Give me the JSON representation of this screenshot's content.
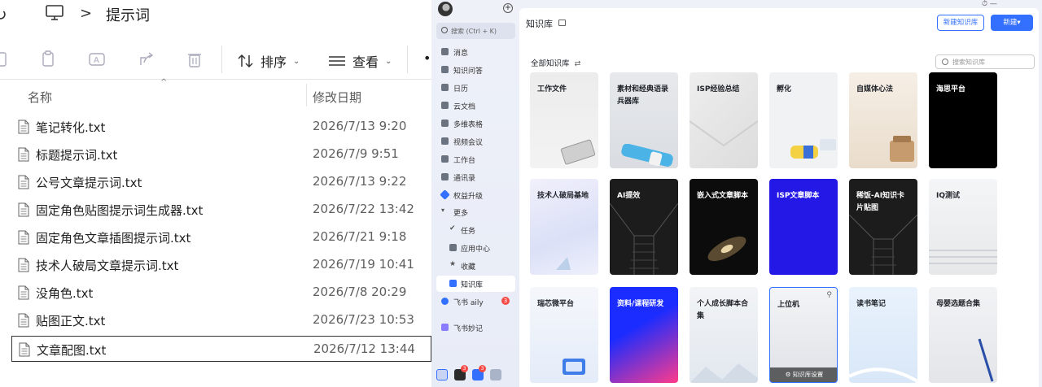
{
  "explorer": {
    "breadcrumb": "提示词",
    "toolbar": {
      "sort_label": "排序",
      "view_label": "查看"
    },
    "columns": {
      "name": "名称",
      "date": "修改日期"
    },
    "files": [
      {
        "name": "笔记转化.txt",
        "date": "2026/7/13 9:20"
      },
      {
        "name": "标题提示词.txt",
        "date": "2026/7/9 9:51"
      },
      {
        "name": "公号文章提示词.txt",
        "date": "2026/7/13 9:22"
      },
      {
        "name": "固定角色贴图提示词生成器.txt",
        "date": "2026/7/22 13:42"
      },
      {
        "name": "固定角色文章插图提示词.txt",
        "date": "2026/7/21 9:18"
      },
      {
        "name": "技术人破局文章提示词.txt",
        "date": "2026/7/19 10:41"
      },
      {
        "name": "没角色.txt",
        "date": "2026/7/8 20:29"
      },
      {
        "name": "贴图正文.txt",
        "date": "2026/7/23 10:53"
      },
      {
        "name": "文章配图.txt",
        "date": "2026/7/12 13:44"
      }
    ]
  },
  "feishu": {
    "search_placeholder": "搜索 (Ctrl + K)",
    "nav": [
      {
        "label": "消息"
      },
      {
        "label": "知识问答"
      },
      {
        "label": "日历"
      },
      {
        "label": "云文档"
      },
      {
        "label": "多维表格"
      },
      {
        "label": "视频会议"
      },
      {
        "label": "工作台"
      },
      {
        "label": "通讯录"
      },
      {
        "label": "权益升级"
      },
      {
        "label": "更多"
      },
      {
        "label": "任务"
      },
      {
        "label": "应用中心"
      },
      {
        "label": "收藏"
      },
      {
        "label": "知识库"
      },
      {
        "label": "飞书 aily",
        "badge": "3"
      },
      {
        "label": "飞书妙记"
      }
    ],
    "bottom_badges": [
      "3",
      "3"
    ],
    "page_title": "知识库",
    "btn_new_kb": "新建知识库",
    "btn_new": "新建▾",
    "all_kb_label": "全部知识库",
    "all_kb_icon": "⇄",
    "kb_search_placeholder": "搜索知识库",
    "top_fragment": "⏱  —",
    "cards": [
      {
        "label": "工作文件"
      },
      {
        "label": "素材和经典语录兵器库"
      },
      {
        "label": "ISP经验总结"
      },
      {
        "label": "孵化"
      },
      {
        "label": "自媒体心法"
      },
      {
        "label": "海思平台"
      },
      {
        "label": "技术人破局基地"
      },
      {
        "label": "AI提效"
      },
      {
        "label": "嵌入式文章脚本"
      },
      {
        "label": "ISP文章脚本"
      },
      {
        "label": "稀饭-AI知识卡片贴图"
      },
      {
        "label": "IQ测试"
      },
      {
        "label": "瑞芯微平台"
      },
      {
        "label": "资料/课程研发"
      },
      {
        "label": "个人成长脚本合集"
      },
      {
        "label": "上位机",
        "footer": "⚙ 知识库设置"
      },
      {
        "label": "读书笔记"
      },
      {
        "label": "母婴选题合集"
      }
    ],
    "colors": {
      "accent": "#3370ff",
      "badge": "#f54a45"
    }
  }
}
